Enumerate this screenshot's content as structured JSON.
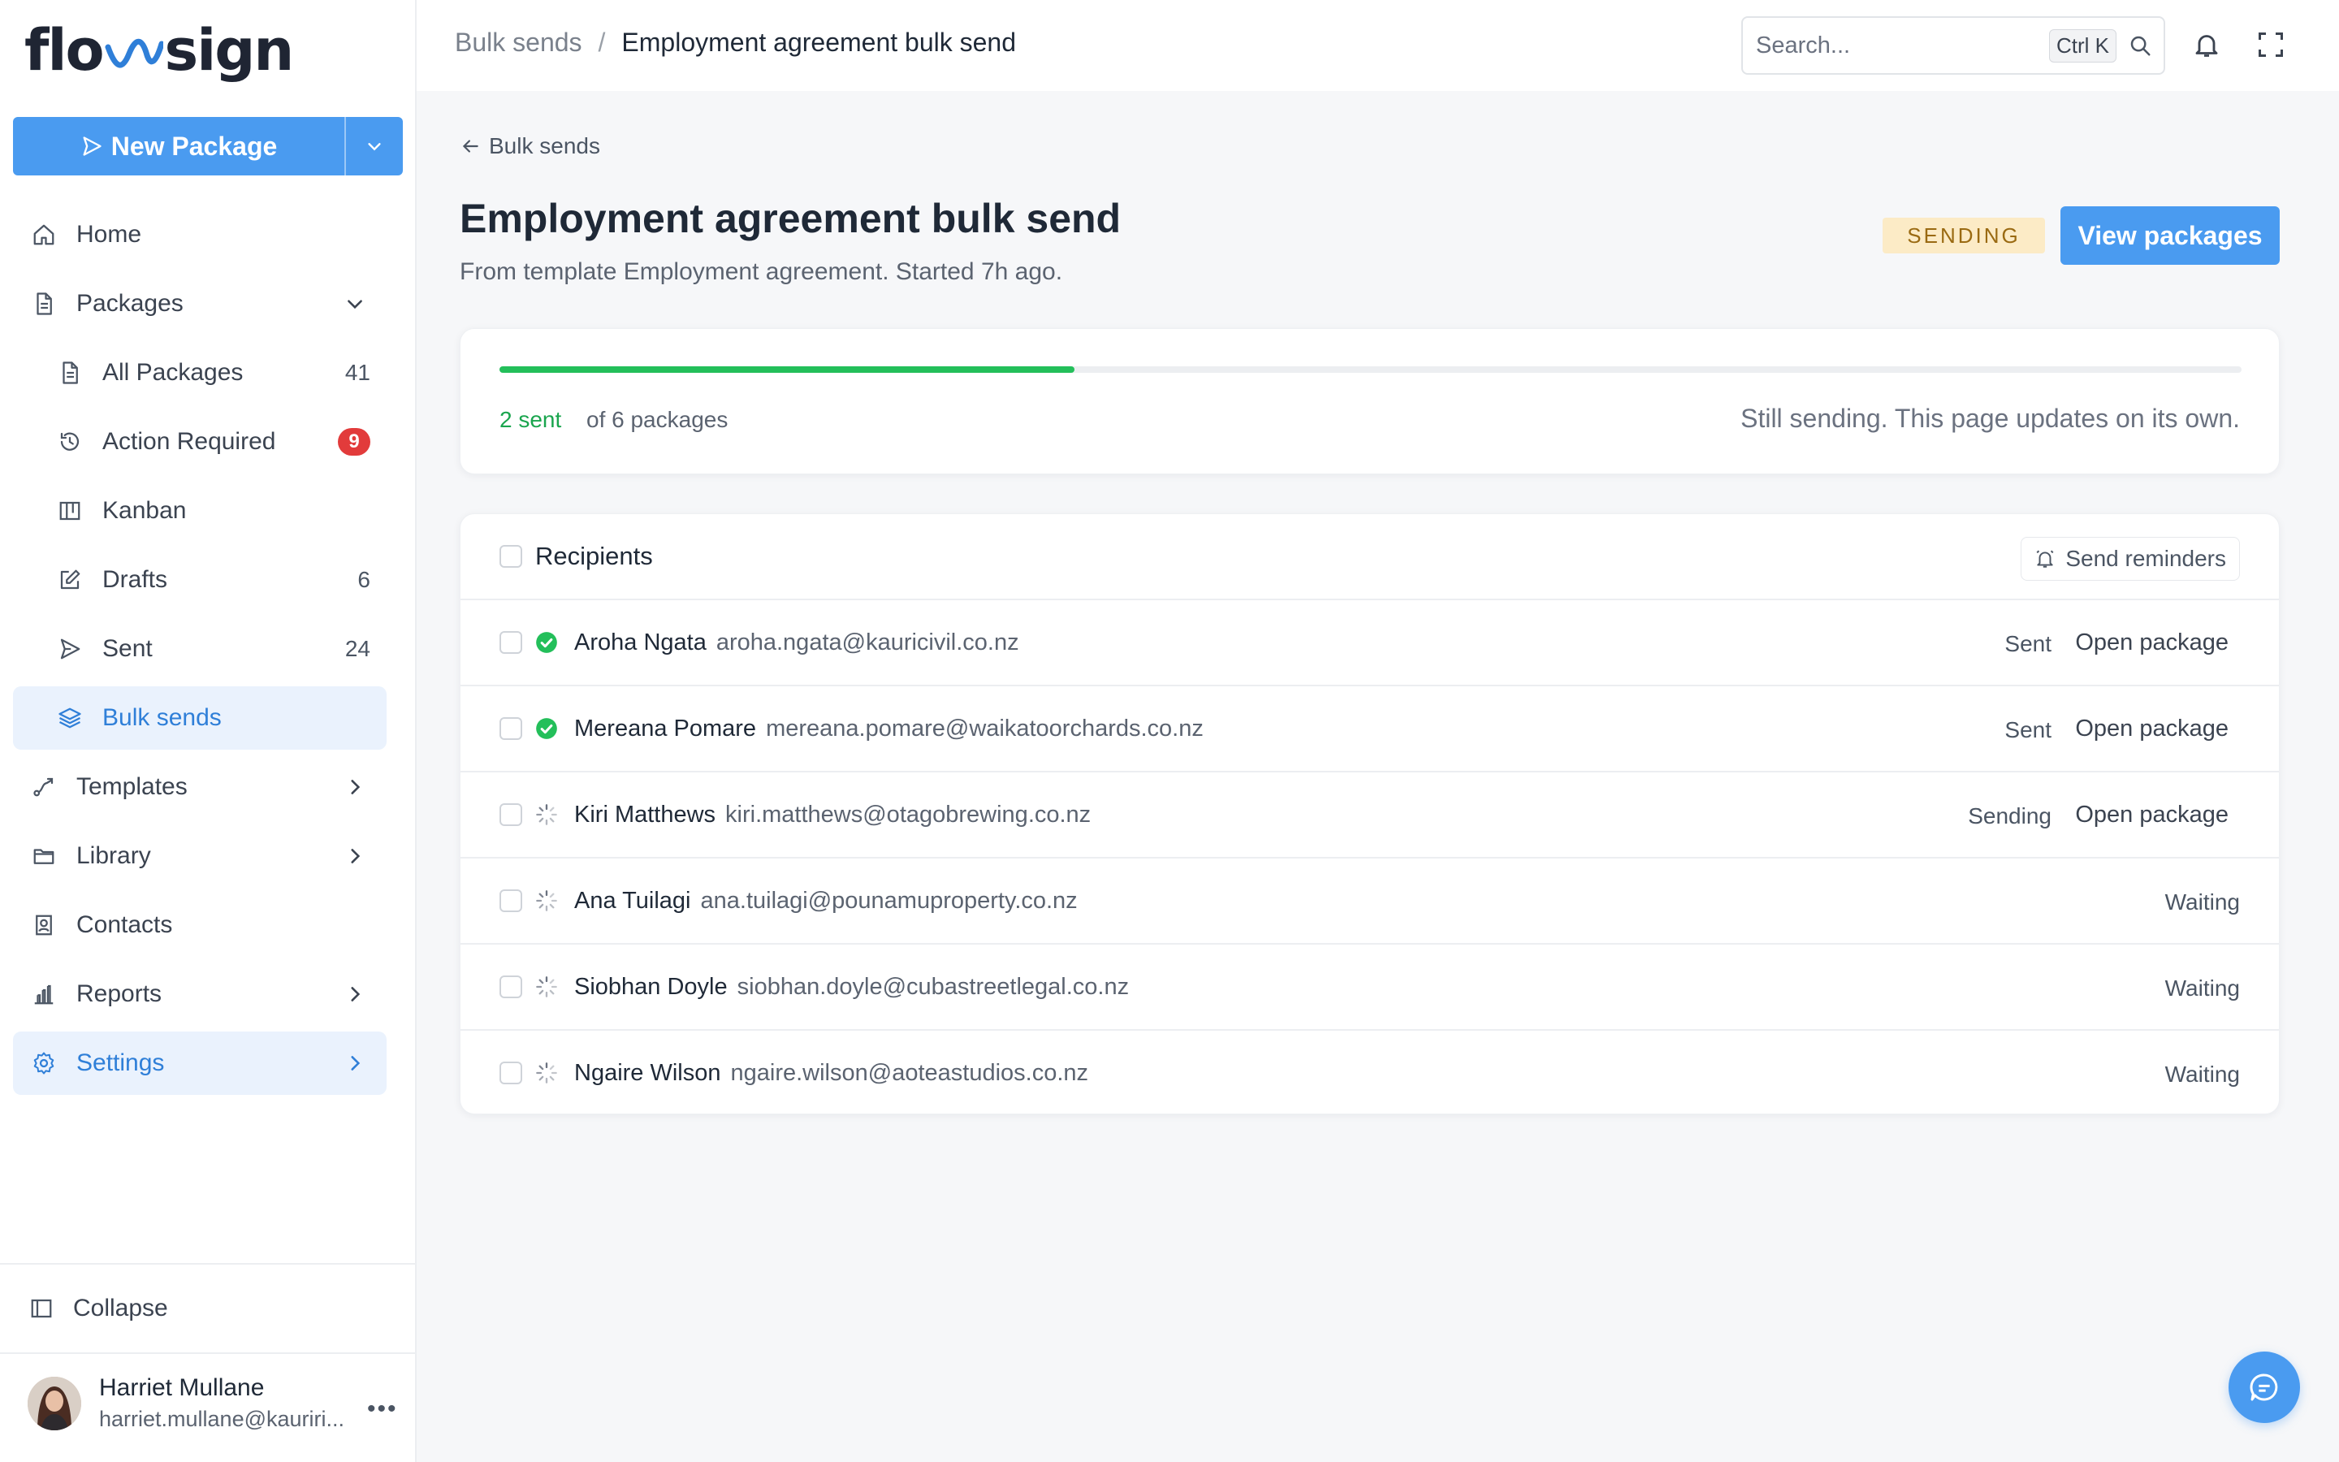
{
  "app": {
    "logo_text_left": "flo",
    "logo_text_right": "sign",
    "accent": "#4a9bf0"
  },
  "sidebar": {
    "new_package_label": "New Package",
    "items": [
      {
        "label": "Home",
        "icon": "home-icon"
      },
      {
        "label": "Packages",
        "icon": "document-icon"
      },
      {
        "label": "All Packages",
        "icon": "document-icon",
        "count": "41"
      },
      {
        "label": "Action Required",
        "icon": "history-icon",
        "badge": "9"
      },
      {
        "label": "Kanban",
        "icon": "kanban-icon"
      },
      {
        "label": "Drafts",
        "icon": "edit-icon",
        "count": "6"
      },
      {
        "label": "Sent",
        "icon": "send-icon",
        "count": "24"
      },
      {
        "label": "Bulk sends",
        "icon": "layers-icon"
      },
      {
        "label": "Templates",
        "icon": "route-icon"
      },
      {
        "label": "Library",
        "icon": "folder-icon"
      },
      {
        "label": "Contacts",
        "icon": "contacts-icon"
      },
      {
        "label": "Reports",
        "icon": "bar-chart-icon"
      },
      {
        "label": "Settings",
        "icon": "gear-icon"
      }
    ],
    "collapse_label": "Collapse",
    "user": {
      "name": "Harriet Mullane",
      "email": "harriet.mullane@kauriri..."
    }
  },
  "topbar": {
    "breadcrumb_parent": "Bulk sends",
    "breadcrumb_sep": "/",
    "breadcrumb_current": "Employment agreement bulk send",
    "search_placeholder": "Search...",
    "search_shortcut": "Ctrl K"
  },
  "main": {
    "back_label": "Bulk sends",
    "title": "Employment agreement bulk send",
    "subtitle": "From template Employment agreement. Started 7h ago.",
    "status": "SENDING",
    "view_packages_label": "View packages",
    "progress": {
      "sent_label": "2 sent",
      "of_label": "of 6 packages",
      "fraction": 0.33,
      "note": "Still sending. This page updates on its own.",
      "fill_color": "#23bf5a"
    },
    "recipients": {
      "header_label": "Recipients",
      "send_reminders_label": "Send reminders",
      "rows": [
        {
          "name": "Aroha Ngata",
          "email": "aroha.ngata@kauricivil.co.nz",
          "status": "Sent",
          "open_label": "Open package",
          "state": "done"
        },
        {
          "name": "Mereana Pomare",
          "email": "mereana.pomare@waikatoorchards.co.nz",
          "status": "Sent",
          "open_label": "Open package",
          "state": "done"
        },
        {
          "name": "Kiri Matthews",
          "email": "kiri.matthews@otagobrewing.co.nz",
          "status": "Sending",
          "open_label": "Open package",
          "state": "pending"
        },
        {
          "name": "Ana Tuilagi",
          "email": "ana.tuilagi@pounamuproperty.co.nz",
          "status": "Waiting",
          "open_label": "",
          "state": "pending"
        },
        {
          "name": "Siobhan Doyle",
          "email": "siobhan.doyle@cubastreetlegal.co.nz",
          "status": "Waiting",
          "open_label": "",
          "state": "pending"
        },
        {
          "name": "Ngaire Wilson",
          "email": "ngaire.wilson@aoteastudios.co.nz",
          "status": "Waiting",
          "open_label": "",
          "state": "pending"
        }
      ]
    }
  }
}
